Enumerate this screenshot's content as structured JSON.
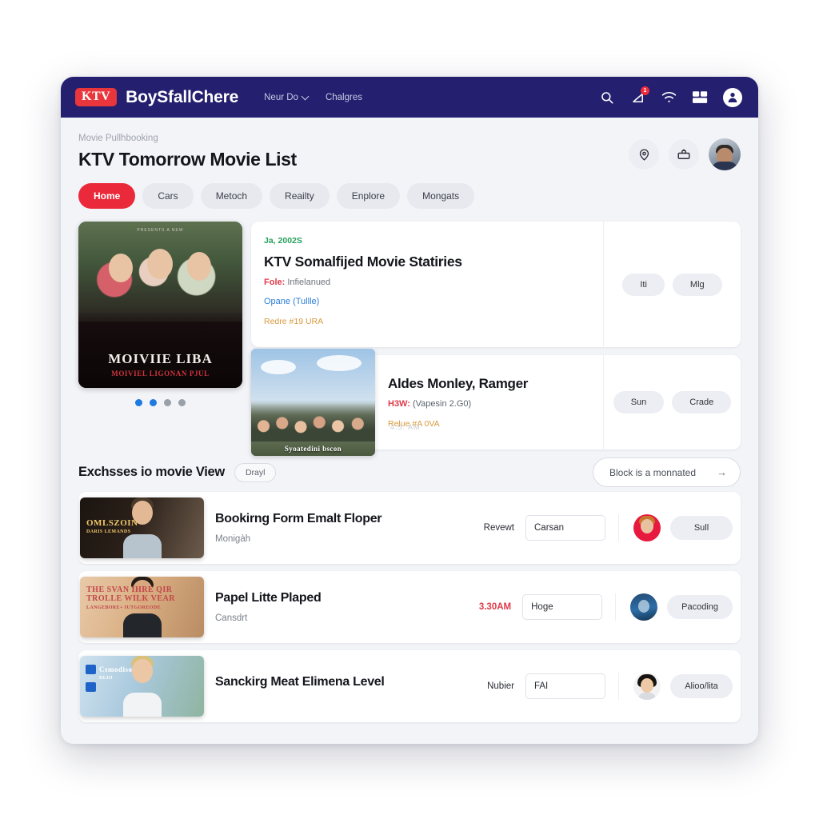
{
  "navbar": {
    "logo_text": "KTV",
    "brand": "BoySfallChere",
    "links": [
      {
        "label": "Neur Do",
        "has_chevron": true
      },
      {
        "label": "Chalgres",
        "has_chevron": false
      }
    ],
    "icons": [
      "search-icon",
      "notification-bell-icon",
      "wifi-icon",
      "grid-apps-icon",
      "user-account-icon"
    ],
    "notification_count": "1",
    "accent": "#241f6e",
    "logo_color": "#e8363c"
  },
  "header": {
    "breadcrumb": "Movie Pullhbooking",
    "title": "KTV Tomorrow Movie List",
    "actions": [
      "location-pin-icon",
      "briefcase-upload-icon",
      "profile-avatar"
    ]
  },
  "tabs": [
    {
      "label": "Home",
      "active": true
    },
    {
      "label": "Cars",
      "active": false
    },
    {
      "label": "Metoch",
      "active": false
    },
    {
      "label": "Reailty",
      "active": false
    },
    {
      "label": "Enplore",
      "active": false
    },
    {
      "label": "Mongats",
      "active": false
    }
  ],
  "hero": {
    "poster": {
      "tiny": "PRESENTS A NEW",
      "title": "MOIVIIE LIBA",
      "subtitle": "MOIVIEL LIGONAN\nPJUL"
    },
    "carousel_dots": [
      true,
      true,
      false,
      false
    ],
    "card": {
      "date": "Ja, 2002S",
      "title": "KTV Somalfijed Movie Statiries",
      "meta_label": "Fole:",
      "meta_value": "Infielanued",
      "link": "Opane (Tullle)",
      "note": "Redre #19 URA",
      "buttons": [
        "Iti",
        "Mlg"
      ]
    }
  },
  "sub_card": {
    "thumb_title": "Syoatedini bscon",
    "title": "Aldes Monley, Ramger",
    "meta_label": "H3W:",
    "meta_value": "(Vapesin 2.G0)",
    "note": "Relue #A 0VA",
    "buttons": [
      "Sun",
      "Crade"
    ]
  },
  "faint_time": "4.5: AM",
  "section": {
    "title": "Exchsses io movie View",
    "chip": "Drayl",
    "cta": "Block is a monnated",
    "cta_icon": "arrow-right-icon"
  },
  "rows": [
    {
      "thumb_label": "OMLSZOIN",
      "thumb_sub": "DARIS  LEMANDS",
      "title": "Bookirng Form Emalt Floper",
      "subtitle": "Monigàh",
      "time": "Revewt",
      "time_red": false,
      "input_value": "Carsan",
      "avatar": "avatar-red",
      "button": "Sull"
    },
    {
      "thumb_label": "THE SVAN\nIHRE QIR TROLLE\nWILK VEAR",
      "thumb_sub": "LANGEBORE+\nIUTGOREODE",
      "title": "Papel Litte Plaped",
      "subtitle": "Cansdrt",
      "time": "3.30AM",
      "time_red": true,
      "input_value": "Hoge",
      "avatar": "avatar-blue",
      "button": "Pacoding"
    },
    {
      "thumb_label": "Csmodiso",
      "thumb_sub": "DLIO",
      "title": "Sanckirg Meat Elimena Level",
      "subtitle": "",
      "time": "Nubier",
      "time_red": false,
      "input_value": "FAI",
      "avatar": "avatar-dark",
      "button": "Alioo/lita"
    }
  ]
}
